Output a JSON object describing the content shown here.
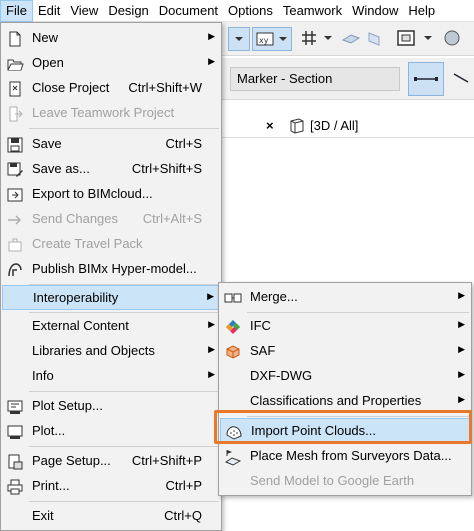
{
  "menubar": [
    "File",
    "Edit",
    "View",
    "Design",
    "Document",
    "Options",
    "Teamwork",
    "Window",
    "Help"
  ],
  "toolbar": {
    "marker_label": "Marker - Section"
  },
  "view_tab": {
    "close_glyph": "×",
    "label": "[3D / All]"
  },
  "file_menu": {
    "new": "New",
    "open": "Open",
    "close_project": "Close Project",
    "close_project_sc": "Ctrl+Shift+W",
    "leave_teamwork": "Leave Teamwork Project",
    "save": "Save",
    "save_sc": "Ctrl+S",
    "save_as": "Save as...",
    "save_as_sc": "Ctrl+Shift+S",
    "export_bimcloud": "Export to BIMcloud...",
    "send_changes": "Send Changes",
    "send_changes_sc": "Ctrl+Alt+S",
    "create_travel_pack": "Create Travel Pack",
    "publish_bimx": "Publish BIMx Hyper-model...",
    "interoperability": "Interoperability",
    "external_content": "External Content",
    "libraries_objects": "Libraries and Objects",
    "info": "Info",
    "plot_setup": "Plot Setup...",
    "plot": "Plot...",
    "page_setup": "Page Setup...",
    "page_setup_sc": "Ctrl+Shift+P",
    "print": "Print...",
    "print_sc": "Ctrl+P",
    "exit": "Exit",
    "exit_sc": "Ctrl+Q"
  },
  "interop_menu": {
    "merge": "Merge...",
    "ifc": "IFC",
    "saf": "SAF",
    "dxf_dwg": "DXF-DWG",
    "classifications": "Classifications and Properties",
    "import_point_clouds": "Import Point Clouds...",
    "place_mesh": "Place Mesh from Surveyors Data...",
    "send_model_google": "Send Model to Google Earth"
  },
  "colors": {
    "highlight": "#cce4f7",
    "highlight_border": "#99c9ef",
    "callout_frame": "#e8782a",
    "disabled_text": "#a0a0a0"
  }
}
